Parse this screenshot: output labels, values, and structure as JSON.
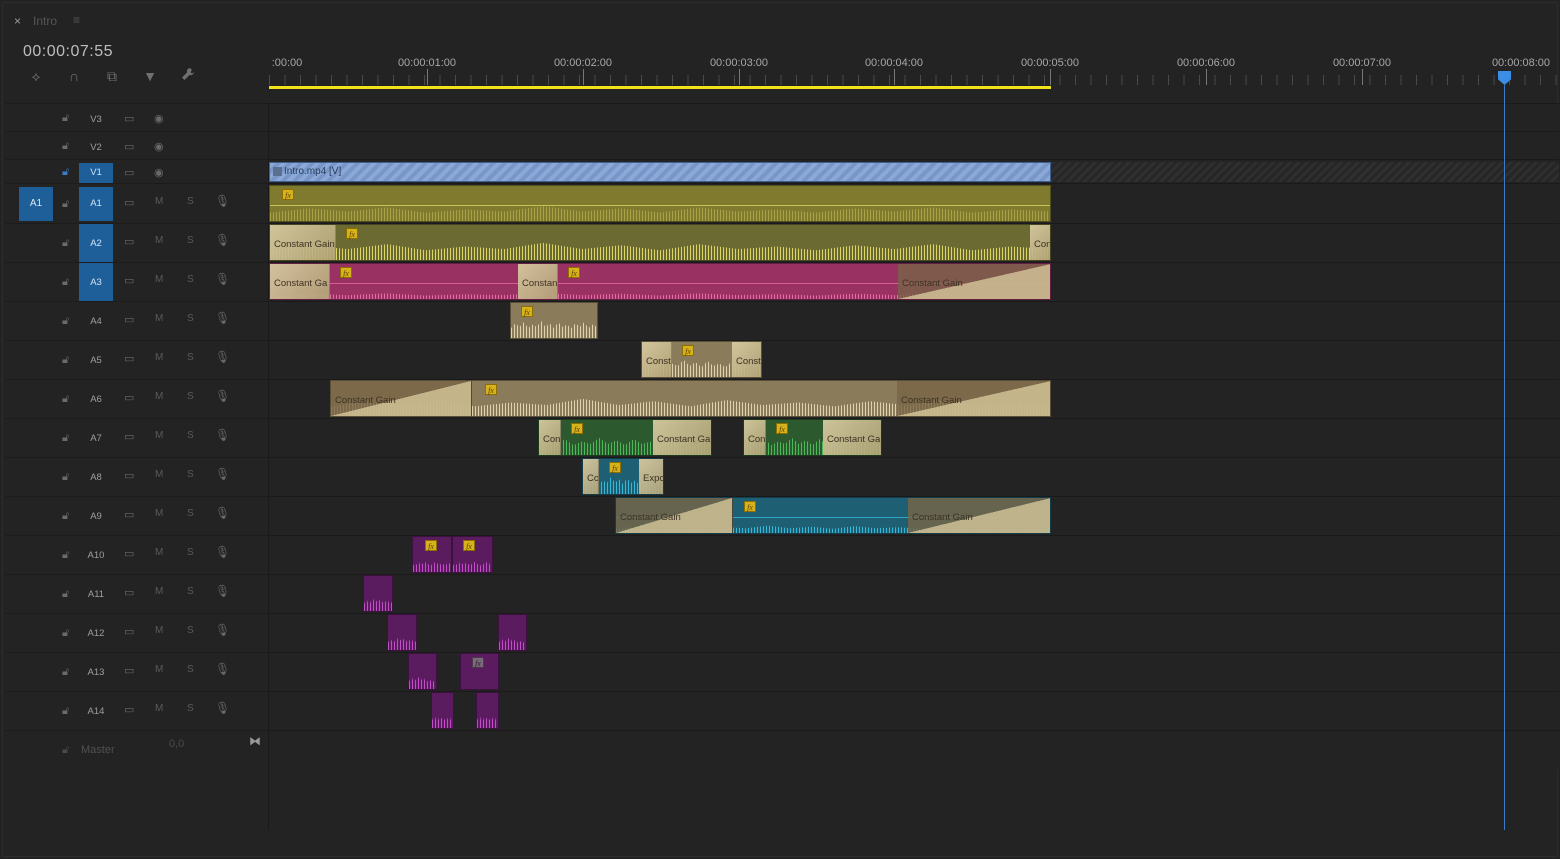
{
  "panel": {
    "close": "×",
    "title": "Intro",
    "menu": "≡"
  },
  "timecode": "00:00:07:55",
  "tools": [
    {
      "name": "snap-icon",
      "glyph": "⟡"
    },
    {
      "name": "magnet-icon",
      "glyph": "∩"
    },
    {
      "name": "linked-selection-icon",
      "glyph": "⧉"
    },
    {
      "name": "add-marker-icon",
      "glyph": "▼"
    },
    {
      "name": "wrench-icon",
      "glyph": "🔧"
    }
  ],
  "ruler": {
    "labels": [
      ":00:00",
      "00:00:01:00",
      "00:00:02:00",
      "00:00:03:00",
      "00:00:04:00",
      "00:00:05:00",
      "00:00:06:00",
      "00:00:07:00",
      "00:00:08:00"
    ]
  },
  "colors": {
    "yellow": "#7f7a2e",
    "yellow_wave": "#e8e16a",
    "olive": "#6b6a33",
    "pink": "#9a3163",
    "pink_wave": "#f070b0",
    "tan": "#8a7c5a",
    "tan_wave": "#d9cba2",
    "green": "#2c5a2e",
    "green_wave": "#4ec55a",
    "cyan": "#1f5f74",
    "cyan_wave": "#35c4e6",
    "purple": "#5a1c5e",
    "purple_wave": "#d050d8",
    "playhead": "#3a8ee6",
    "workarea": "#f0e31a"
  },
  "tracks": {
    "video": [
      {
        "name": "V3"
      },
      {
        "name": "V2"
      },
      {
        "name": "V1"
      }
    ],
    "audio": [
      {
        "name": "A1",
        "source": "A1"
      },
      {
        "name": "A2"
      },
      {
        "name": "A3"
      },
      {
        "name": "A4"
      },
      {
        "name": "A5"
      },
      {
        "name": "A6"
      },
      {
        "name": "A7"
      },
      {
        "name": "A8"
      },
      {
        "name": "A9"
      },
      {
        "name": "A10"
      },
      {
        "name": "A11"
      },
      {
        "name": "A12"
      },
      {
        "name": "A13"
      },
      {
        "name": "A14"
      }
    ],
    "labels": {
      "m": "M",
      "s": "S"
    },
    "master": {
      "name": "Master",
      "value": "0,0",
      "icon": "⧓"
    }
  },
  "clips": {
    "video_v1": {
      "label": "Intro.mp4 [V]"
    },
    "fx": "fx",
    "transitions": {
      "a2_start": "Constant Gain",
      "a2_end": "Con",
      "a3_start": "Constant Ga",
      "a3_mid": "Constan",
      "a3_end": "Constant Gain",
      "a5_start": "Const",
      "a5_end": "Consta",
      "a6_start": "Constant Gain",
      "a6_end": "Constant Gain",
      "a7_a_start": "Con",
      "a7_a_end": "Constant Ga",
      "a7_b_start": "Con",
      "a7_b_end": "Constant Ga",
      "a8_start": "Co",
      "a8_end": "Expo",
      "a9_start": "Constant Gain",
      "a9_end": "Constant Gain"
    }
  }
}
